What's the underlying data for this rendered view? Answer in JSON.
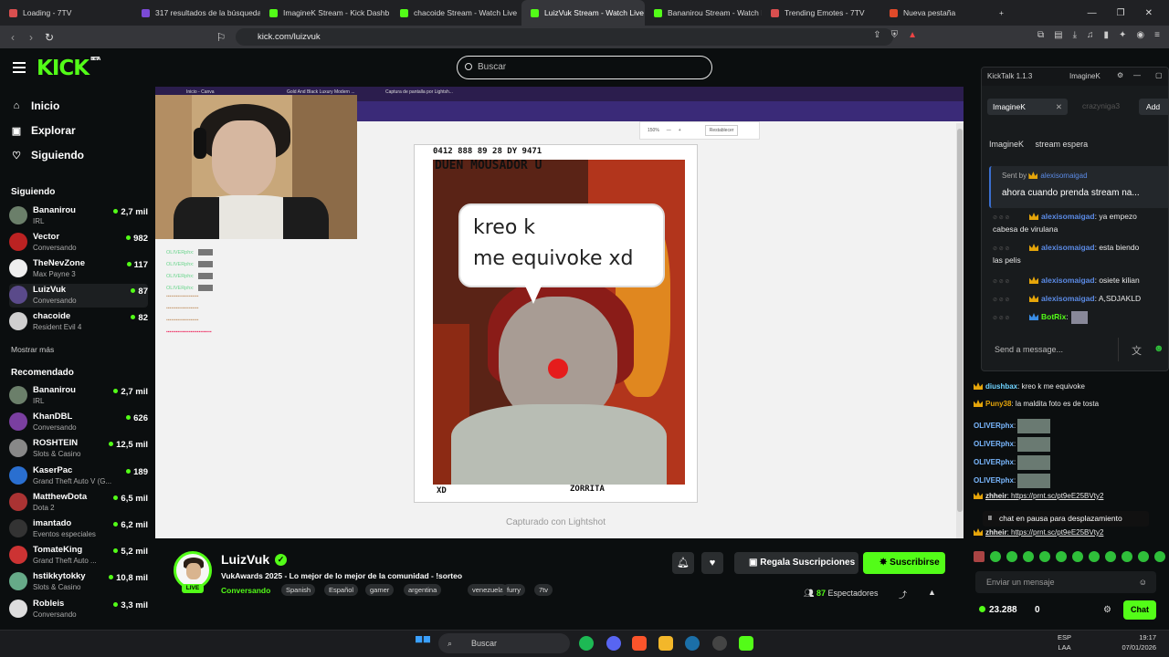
{
  "browser": {
    "tabs": [
      {
        "label": "Loading - 7TV",
        "color": "#d94f4f"
      },
      {
        "label": "317 resultados de la búsqueda",
        "color": "#7b4ad6"
      },
      {
        "label": "ImagineK Stream - Kick Dashb",
        "color": "#53fc18"
      },
      {
        "label": "chacoide Stream - Watch Live",
        "color": "#53fc18"
      },
      {
        "label": "LuizVuk Stream - Watch Live",
        "color": "#53fc18",
        "active": true
      },
      {
        "label": "Bananirou Stream - Watch Live",
        "color": "#53fc18"
      },
      {
        "label": "Trending Emotes - 7TV",
        "color": "#d94f4f"
      },
      {
        "label": "Nueva pestaña",
        "color": "#e04a2a"
      }
    ],
    "url": "kick.com/luizvuk"
  },
  "header": {
    "logo": "KICK",
    "logo_badge": "BETA",
    "search_placeholder": "Buscar"
  },
  "sidebar": {
    "nav": [
      "Inicio",
      "Explorar",
      "Siguiendo"
    ],
    "following_heading": "Siguiendo",
    "following": [
      {
        "name": "Bananirou",
        "category": "IRL",
        "viewers": "2,7 mil",
        "color": "#6b7f6a"
      },
      {
        "name": "Vector",
        "category": "Conversando",
        "viewers": "982",
        "color": "#b22"
      },
      {
        "name": "TheNevZone",
        "category": "Max Payne 3",
        "viewers": "117",
        "color": "#eee"
      },
      {
        "name": "LuizVuk",
        "category": "Conversando",
        "viewers": "87",
        "color": "#5a4a8a"
      },
      {
        "name": "chacoide",
        "category": "Resident Evil 4",
        "viewers": "82",
        "color": "#cfcfcf"
      }
    ],
    "show_more": "Mostrar más",
    "recommended_heading": "Recomendado",
    "recommended": [
      {
        "name": "Bananirou",
        "category": "IRL",
        "viewers": "2,7 mil",
        "color": "#6b7f6a"
      },
      {
        "name": "KhanDBL",
        "category": "Conversando",
        "viewers": "626",
        "color": "#7a3fa0"
      },
      {
        "name": "ROSHTEIN",
        "category": "Slots & Casino",
        "viewers": "12,5 mil",
        "color": "#888"
      },
      {
        "name": "KaserPac",
        "category": "Grand Theft Auto V (G...",
        "viewers": "189",
        "color": "#2a6fd0"
      },
      {
        "name": "MatthewDota",
        "category": "Dota 2",
        "viewers": "6,5 mil",
        "color": "#a33"
      },
      {
        "name": "imantado",
        "category": "Eventos especiales",
        "viewers": "6,2 mil",
        "color": "#333"
      },
      {
        "name": "TomateKing",
        "category": "Grand Theft Auto ...",
        "viewers": "5,2 mil",
        "color": "#c33"
      },
      {
        "name": "hstikkytokky",
        "category": "Slots & Casino",
        "viewers": "10,8 mil",
        "color": "#6a8"
      },
      {
        "name": "Robleis",
        "category": "Conversando",
        "viewers": "3,3 mil",
        "color": "#ddd"
      }
    ]
  },
  "player": {
    "inner_tabs": [
      "Inicio - Canva",
      "Gold And Black Luxury Modern ...",
      "Captura de pantalla por Lightsh..."
    ],
    "zoom": "150%",
    "reset": "Restablecer",
    "overlay_chat": [
      "OLIVERphx:",
      "OLIVERphx:",
      "OLIVERphx:",
      "OLIVERphx:"
    ],
    "card_top": "0412 888 89 28   DY 9471",
    "card_head": "DUEN MOUSADOR U",
    "bubble_line1": "kreo k",
    "bubble_line2": "me equivoke xd",
    "card_bottom_left": "XD",
    "card_bottom_right": "ZORRITA",
    "caption": "Capturado con Lightshot"
  },
  "stream": {
    "name": "LuizVuk",
    "live": "LIVE",
    "title": "VukAwards 2025 - Lo mejor de lo mejor de la comunidad - !sorteo",
    "category": "Conversando",
    "tags": [
      "Spanish",
      "Español",
      "gamer",
      "argentina",
      "venezuela",
      "furry",
      "7tv"
    ],
    "gift_label": "Regala Suscripciones",
    "subscribe_label": "Suscribirse",
    "viewers_count": "87",
    "viewers_label": "Espectadores"
  },
  "kicktalk": {
    "title": "KickTalk 1.1.3",
    "user": "ImagineK",
    "tab": "ImagineK",
    "tab_ghost": "crazyniga3",
    "add": "Add",
    "channel": "ImagineK",
    "channel_status": "stream espera",
    "pinned_sent_by": "Sent by",
    "pinned_user": "alexisomaigad",
    "pinned_msg": "ahora cuando prenda stream na...",
    "messages": [
      {
        "user": "alexisomaigad",
        "text": ": ya empezo",
        "cont": "cabesa de virulana"
      },
      {
        "user": "alexisomaigad",
        "text": ": esta biendo",
        "cont": "las pelis"
      },
      {
        "user": "alexisomaigad",
        "text": ": osiete kilian",
        "cont": ""
      },
      {
        "user": "alexisomaigad",
        "text": ": A,SDJAKLD",
        "cont": ""
      },
      {
        "user": "BotRix",
        "text": ":",
        "cont": ""
      }
    ],
    "send_placeholder": "Send a message..."
  },
  "chat": {
    "messages": [
      {
        "user": "diushbax",
        "text": ": kreo k me equivoke",
        "color": "#6fd3ff"
      },
      {
        "user": "Puny38",
        "text": ": la maldita foto es de tosta",
        "color": "#e5a50a"
      },
      {
        "user": "OLIVERphx",
        "text": ":",
        "color": "#7ab8ff"
      },
      {
        "user": "OLIVERphx",
        "text": ":",
        "color": "#7ab8ff"
      },
      {
        "user": "OLIVERphx",
        "text": ":",
        "color": "#7ab8ff"
      },
      {
        "user": "OLIVERphx",
        "text": ":",
        "color": "#7ab8ff"
      },
      {
        "user": "zhheir",
        "text": ": https://prnt.sc/pt9eE25BVty2",
        "color": "#e8e8e8"
      },
      {
        "user": "zhheir",
        "text": ": https://prnt.sc/pt9eE25BVty2",
        "color": "#e8e8e8"
      }
    ],
    "pause_text": "chat en pausa para desplazamiento",
    "send_placeholder": "Enviar un mensaje",
    "points": "23.288",
    "points_secondary": "0",
    "chat_button": "Chat"
  },
  "taskbar": {
    "search": "Buscar",
    "lang1": "ESP",
    "lang2": "LAA",
    "time": "19:17",
    "date": "07/01/2026"
  }
}
